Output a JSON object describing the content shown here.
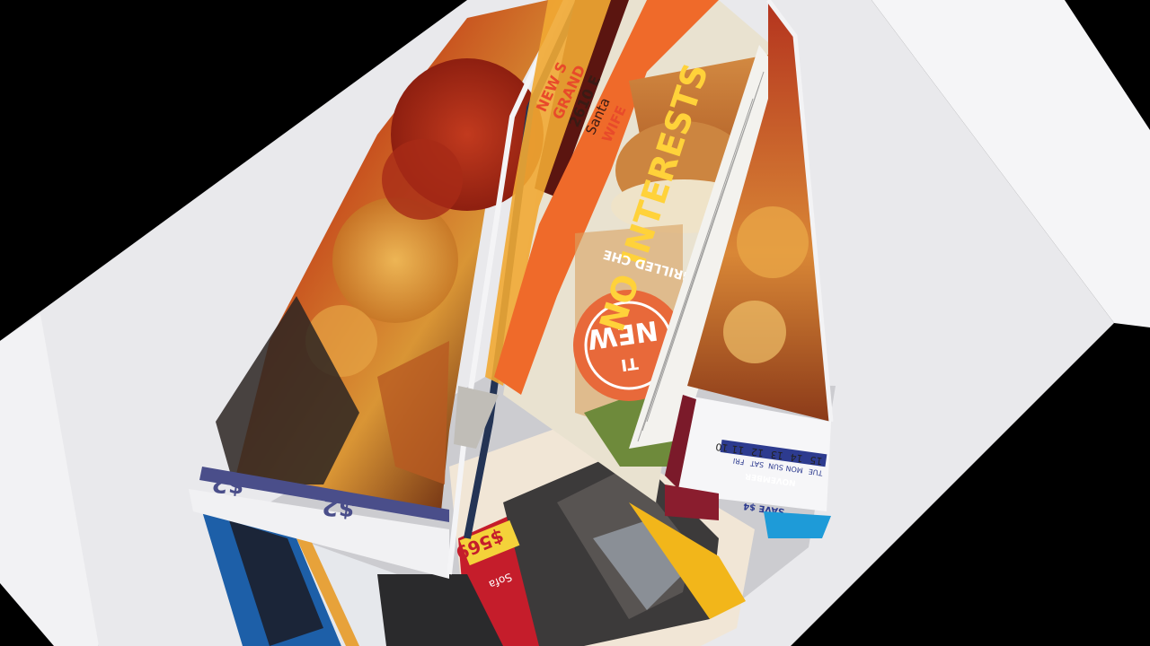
{
  "photo": {
    "background_color": "#000000",
    "paper_color": "#e9e9ec",
    "subject": "folded-advertising-flyers"
  },
  "flyers": {
    "pizza_flyer": {
      "price_label_1": "$2",
      "price_label_2": "$2"
    },
    "restaurant_flyer": {
      "vertical_headline": "NO INTERESTS",
      "upside_down_text": "GRILLED CHE",
      "badge_text": "NEW",
      "badge_subtext": "TI",
      "store_lines": [
        "NEW S",
        "GRAND",
        "2610 E",
        "Santa",
        "WIFE"
      ]
    },
    "calendar_flyer": {
      "month": "NOVEMBER",
      "days": [
        "TUE",
        "MON",
        "SUN",
        "SAT",
        "FRI"
      ],
      "dates": [
        "15",
        "14",
        "13",
        "12",
        "11",
        "10"
      ],
      "save_label": "SAVE $4"
    },
    "furniture_flyer": {
      "price": "$569",
      "tag": "Sofa"
    }
  }
}
